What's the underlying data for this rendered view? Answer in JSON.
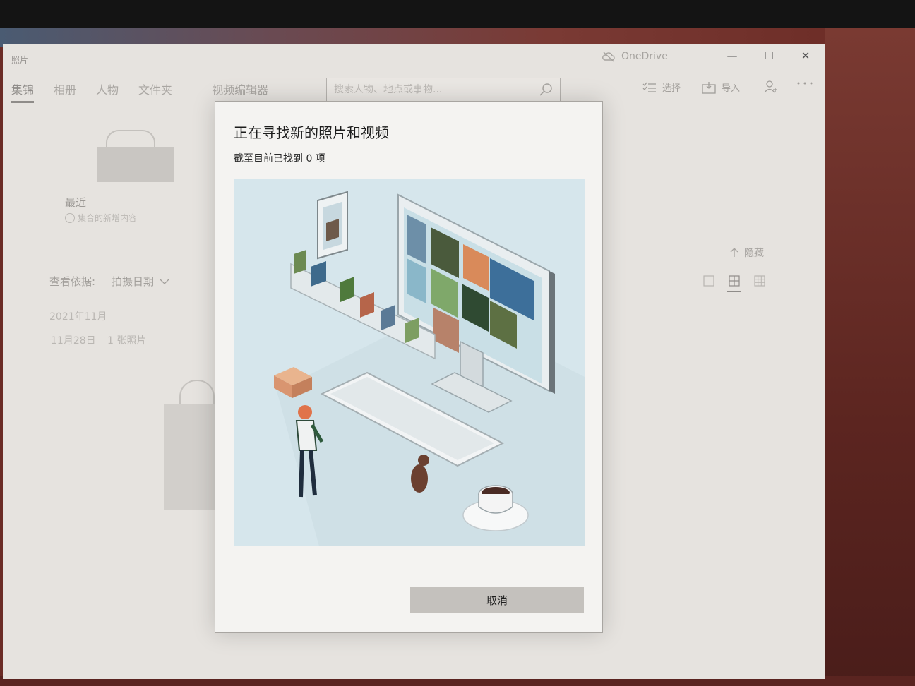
{
  "window": {
    "app_title": "照片",
    "onedrive_label": "OneDrive",
    "controls": {
      "minimize": "—",
      "maximize": "☐",
      "close": "✕"
    }
  },
  "nav": {
    "tabs": [
      {
        "label": "集锦",
        "active": true
      },
      {
        "label": "相册",
        "active": false
      },
      {
        "label": "人物",
        "active": false
      },
      {
        "label": "文件夹",
        "active": false
      },
      {
        "label": "视频编辑器",
        "active": false
      }
    ]
  },
  "search": {
    "placeholder": "搜索人物、地点或事物..."
  },
  "commands": {
    "select": "选择",
    "import": "导入"
  },
  "recent": {
    "title": "最近",
    "subtitle": "集合的新增内容"
  },
  "view": {
    "view_by_label": "查看依据:",
    "view_by_value": "拍摄日期",
    "hide_label": "隐藏"
  },
  "timeline": {
    "month": "2021年11月",
    "day": "11月28日",
    "count": "1 张照片"
  },
  "dialog": {
    "title": "正在寻找新的照片和视频",
    "subtitle": "截至目前已找到 0 项",
    "cancel_label": "取消"
  },
  "colors": {
    "illustration_bg": "#d6e6ec",
    "accent_orange": "#e0734a",
    "dialog_bg": "#f4f3f1",
    "button_bg": "#c4c1bd"
  }
}
